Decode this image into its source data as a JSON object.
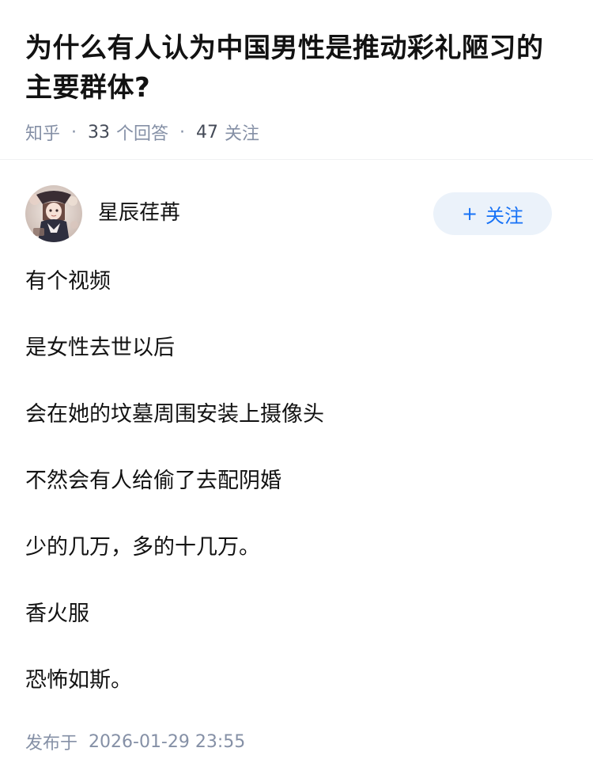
{
  "question": {
    "title": "为什么有人认为中国男性是推动彩礼陋习的主要群体?",
    "source": "知乎",
    "answer_count": "33",
    "answer_label": "个回答",
    "follower_count": "47",
    "follower_label": "关注"
  },
  "answer": {
    "author": {
      "name": "星辰荏苒",
      "avatar_icon": "avatar-anime-girl-icon"
    },
    "follow_button": {
      "plus": "+",
      "label": "关注"
    },
    "paragraphs": [
      "有个视频",
      "是女性去世以后",
      "会在她的坟墓周围安装上摄像头",
      "不然会有人给偷了去配阴婚",
      "少的几万，多的十几万。",
      "香火服",
      "恐怖如斯。"
    ],
    "published_label": "发布于",
    "published_time": "2026-01-29 23:55"
  },
  "colors": {
    "meta_text": "#8590a6",
    "accent_blue": "#1772f6",
    "follow_bg": "#ebf2fa"
  }
}
